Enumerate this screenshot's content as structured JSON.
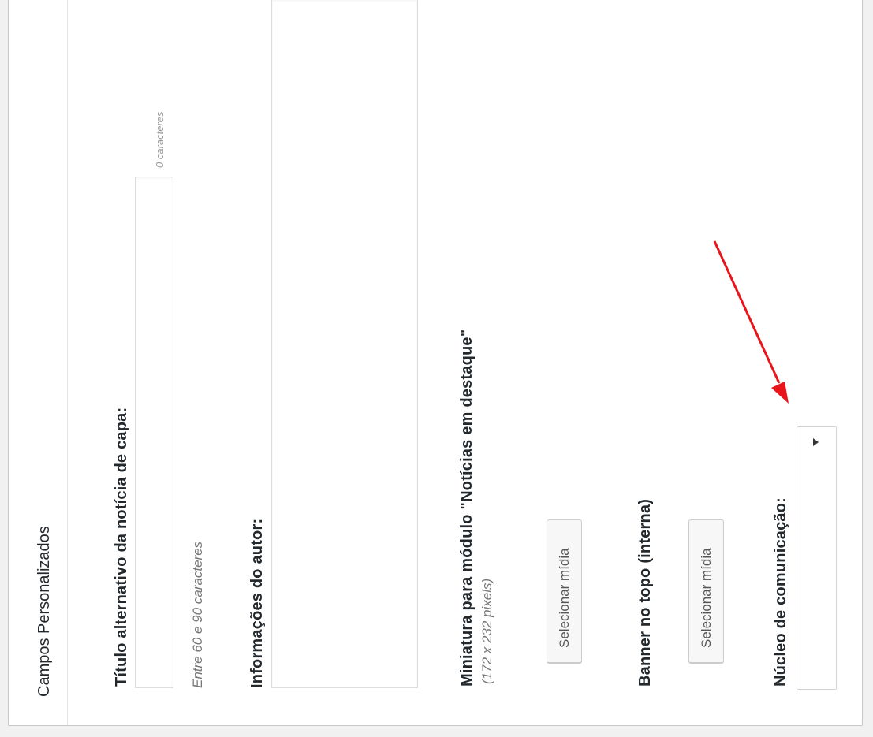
{
  "panel": {
    "title": "Campos Personalizados"
  },
  "fields": {
    "alt_title": {
      "label": "Título alternativo da notícia de capa:",
      "counter": "0 caracteres",
      "hint": "Entre 60 e 90 caracteres",
      "value": ""
    },
    "author_info": {
      "label": "Informações do autor:",
      "value": ""
    },
    "thumbnail": {
      "label": "Miniatura para módulo \"Notícias em destaque\"",
      "hint": "(172 x 232 pixels)",
      "button_label": "Selecionar mídia"
    },
    "banner": {
      "label": "Banner no topo (interna)",
      "button_label": "Selecionar mídia"
    },
    "nucleo": {
      "label": "Núcleo de comunicação:",
      "selected": ""
    }
  },
  "annotation": {
    "arrow_color": "#e8151b"
  }
}
